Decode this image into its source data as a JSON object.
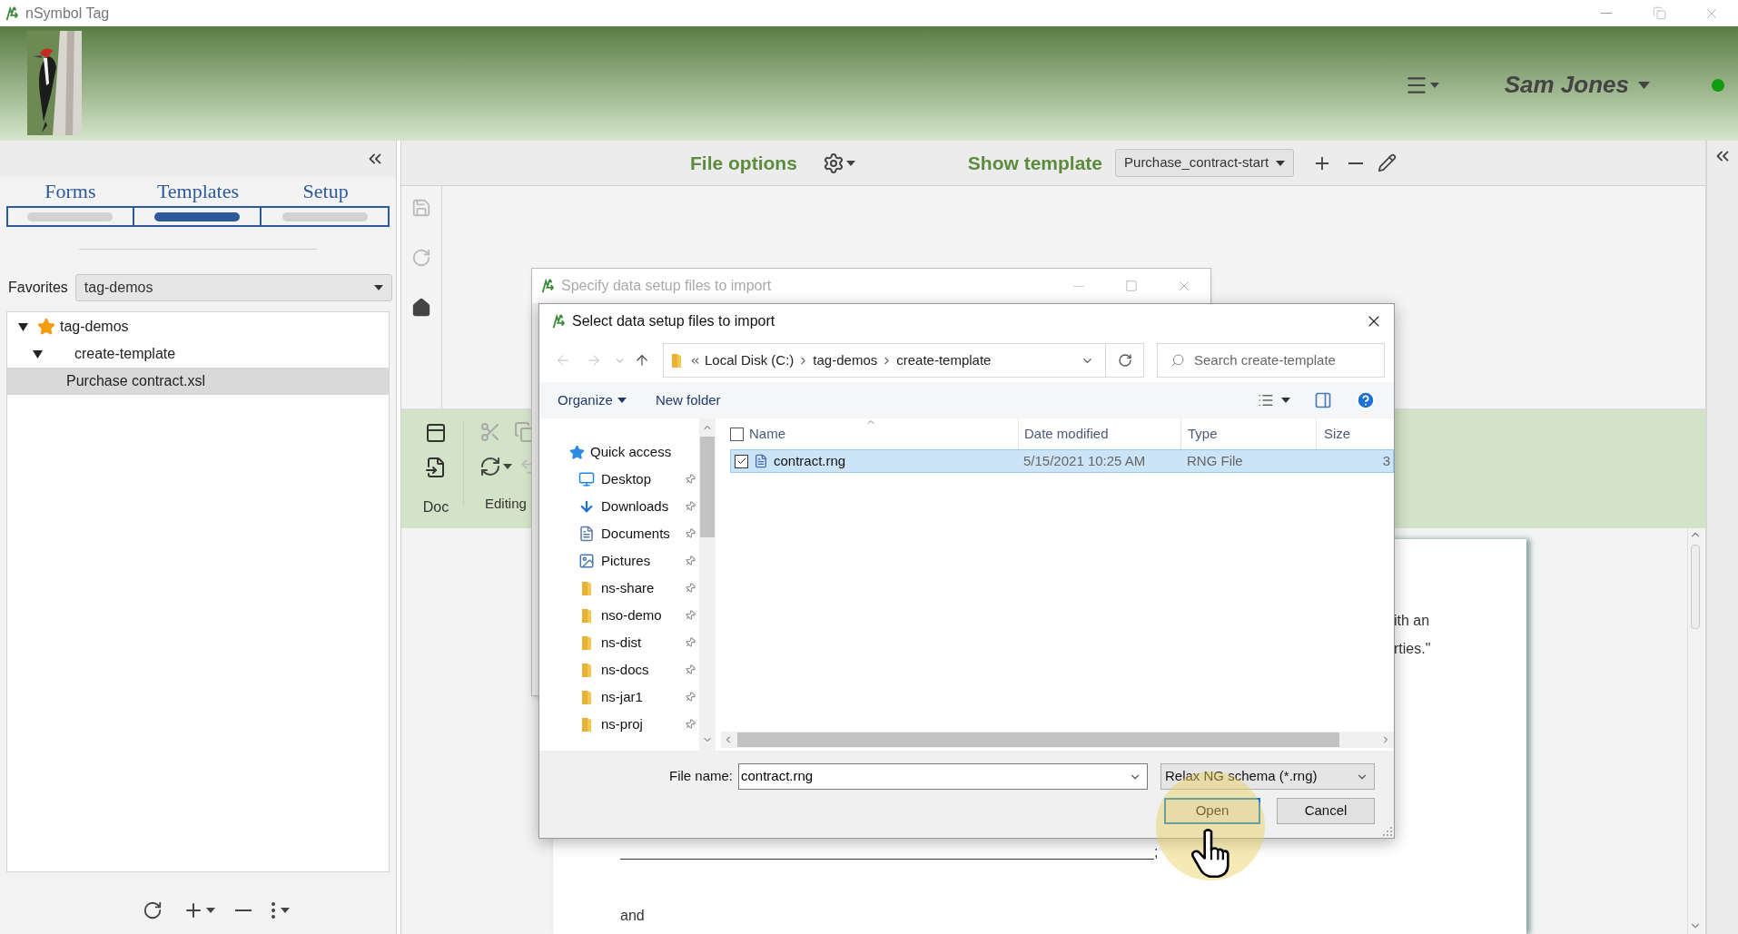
{
  "window": {
    "title": "nSymbol Tag"
  },
  "header": {
    "user": "Sam Jones",
    "online": true
  },
  "sidebar": {
    "tabs": [
      {
        "label": "Forms",
        "selected": false
      },
      {
        "label": "Templates",
        "selected": true
      },
      {
        "label": "Setup",
        "selected": false
      }
    ],
    "favorites": {
      "label": "Favorites",
      "value": "tag-demos"
    },
    "tree": [
      {
        "label": "tag-demos",
        "starred": true,
        "expanded": true,
        "selected": false,
        "children": [
          {
            "label": "create-template",
            "starred": false,
            "expanded": true,
            "selected": false,
            "children": [
              {
                "label": "Purchase contract.xsl",
                "starred": false,
                "expanded": false,
                "selected": true
              }
            ]
          }
        ]
      }
    ]
  },
  "toolbar": {
    "file_options": "File options",
    "show_template": "Show template",
    "template": "Purchase_contract-start"
  },
  "ribbon": {
    "groups": [
      "Doc",
      "Editing"
    ]
  },
  "document": {
    "lines": [
      "ith an",
      "rties.\""
    ],
    "blank_end": ";",
    "last": "and"
  },
  "background_dialog": {
    "title": "Specify data setup files to import"
  },
  "dialog": {
    "title": "Select data setup files to import",
    "path": [
      "Local Disk (C:)",
      "tag-demos",
      "create-template"
    ],
    "search": {
      "placeholder": "Search create-template"
    },
    "organize": "Organize",
    "new_folder": "New folder",
    "quick_access": "Quick access",
    "places": [
      {
        "label": "Desktop",
        "kind": "desktop"
      },
      {
        "label": "Downloads",
        "kind": "downloads"
      },
      {
        "label": "Documents",
        "kind": "documents"
      },
      {
        "label": "Pictures",
        "kind": "pictures"
      },
      {
        "label": "ns-share",
        "kind": "folder"
      },
      {
        "label": "nso-demo",
        "kind": "folder"
      },
      {
        "label": "ns-dist",
        "kind": "folder"
      },
      {
        "label": "ns-docs",
        "kind": "folder"
      },
      {
        "label": "ns-jar1",
        "kind": "folder"
      },
      {
        "label": "ns-proj",
        "kind": "folder"
      }
    ],
    "all_checked": false,
    "columns": [
      "Name",
      "Date modified",
      "Type",
      "Size"
    ],
    "files": [
      {
        "name": "contract.rng",
        "date": "5/15/2021 10:25 AM",
        "type": "RNG File",
        "size": "3",
        "checked": true,
        "selected": true
      }
    ],
    "file_name_label": "File name:",
    "file_name": "contract.rng",
    "filter": "Relax NG schema (*.rng)",
    "buttons": [
      "Open",
      "Cancel"
    ]
  }
}
